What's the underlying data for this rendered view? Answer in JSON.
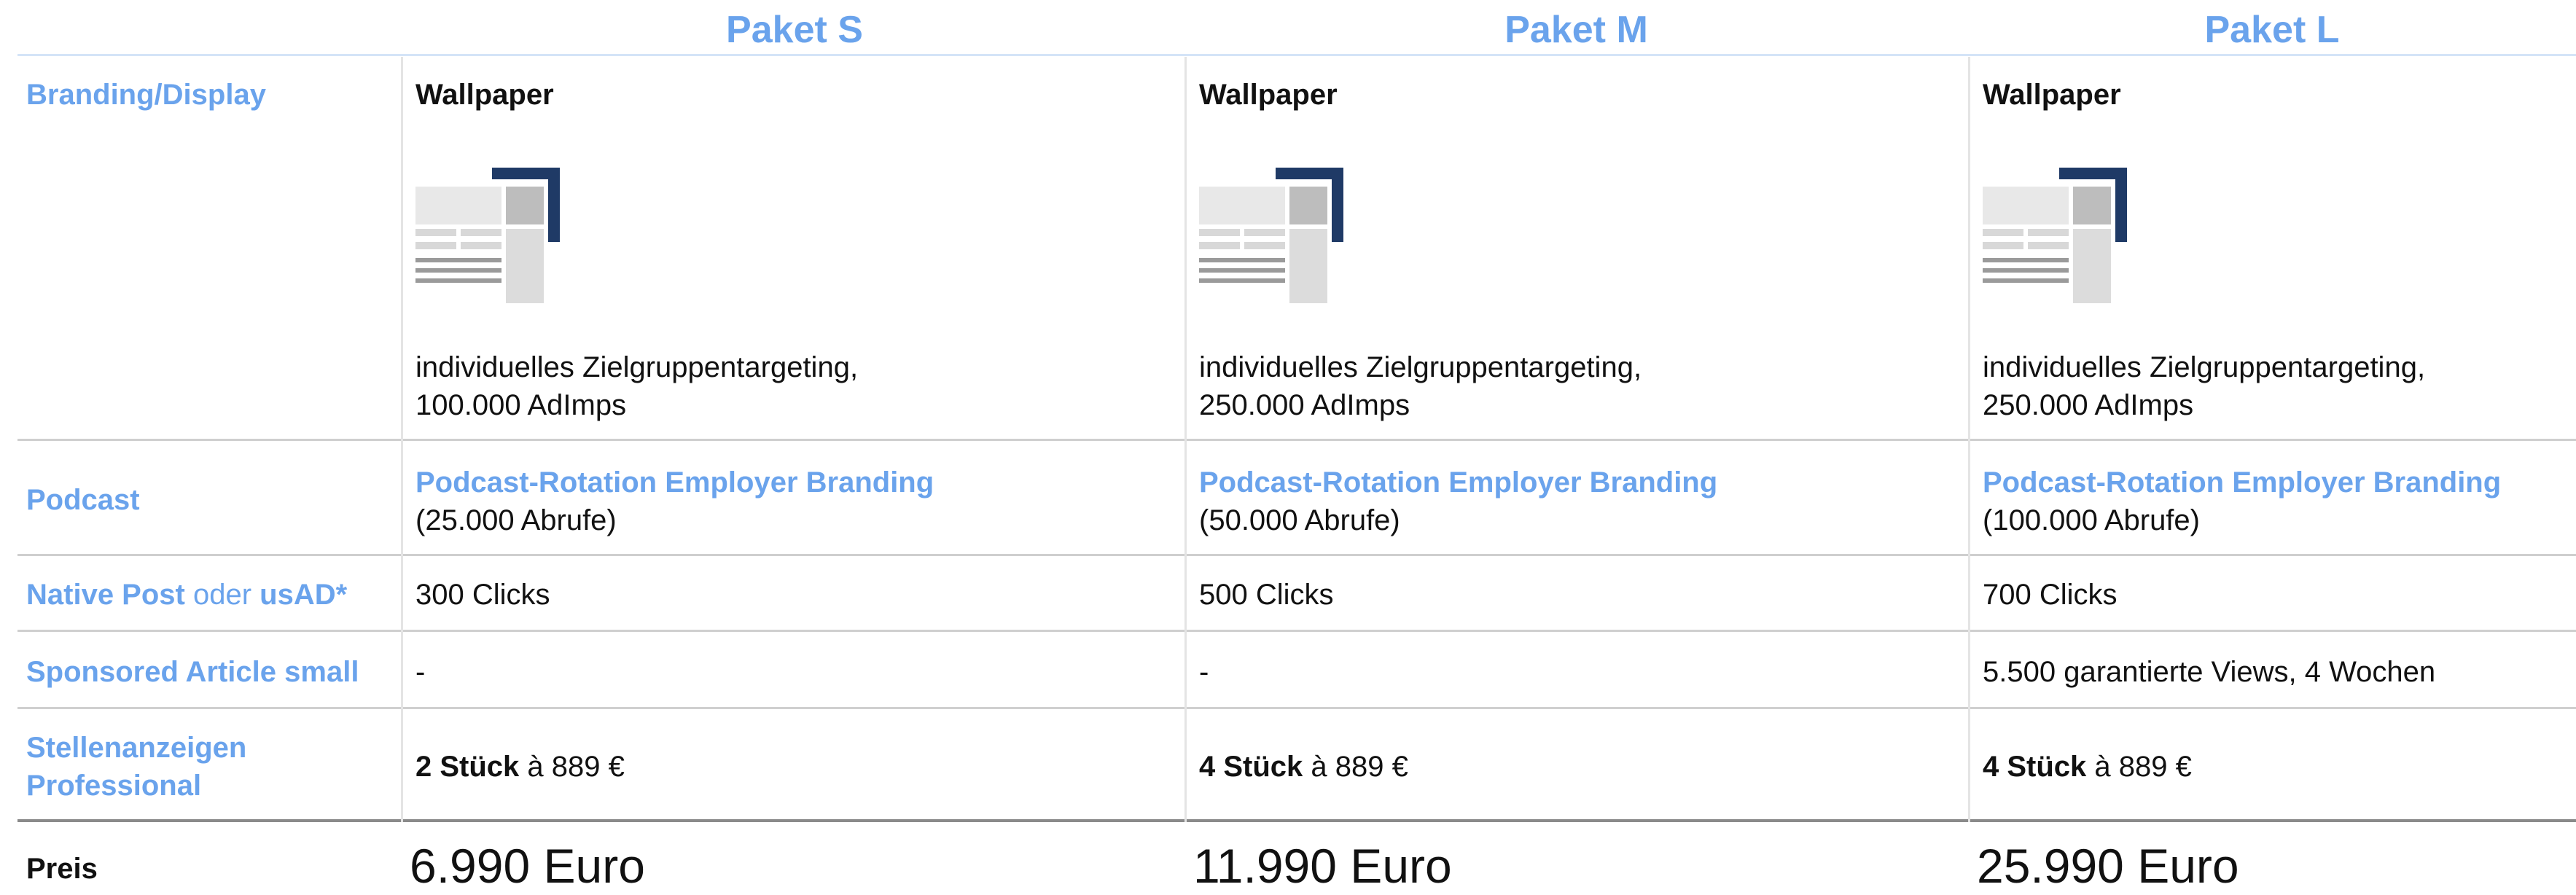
{
  "columns": [
    {
      "title": "Paket S",
      "branding_heading": "Wallpaper",
      "branding_desc": [
        "individuelles Zielgruppentargeting,",
        "100.000 AdImps"
      ],
      "podcast_title": "Podcast-Rotation Employer Branding",
      "podcast_sub": "(25.000 Abrufe)",
      "native": "300 Clicks",
      "sponsored": "-",
      "jobs_bold": "2 Stück",
      "jobs_rest": " à 889 €",
      "price": "6.990 Euro"
    },
    {
      "title": "Paket M",
      "branding_heading": "Wallpaper",
      "branding_desc": [
        "individuelles Zielgruppentargeting,",
        "250.000 AdImps"
      ],
      "podcast_title": "Podcast-Rotation Employer Branding",
      "podcast_sub": "(50.000 Abrufe)",
      "native": "500 Clicks",
      "sponsored": "-",
      "jobs_bold": "4 Stück",
      "jobs_rest": " à 889 €",
      "price": "11.990 Euro"
    },
    {
      "title": "Paket L",
      "branding_heading": "Wallpaper",
      "branding_desc": [
        "individuelles Zielgruppentargeting,",
        "250.000 AdImps"
      ],
      "podcast_title": "Podcast-Rotation Employer Branding",
      "podcast_sub": "(100.000 Abrufe)",
      "native": "700 Clicks",
      "sponsored": "5.500 garantierte Views, 4 Wochen",
      "jobs_bold": "4 Stück",
      "jobs_rest": " à 889 €",
      "price": "25.990 Euro"
    }
  ],
  "rows": {
    "branding": "Branding/Display",
    "podcast": "Podcast",
    "native_a": "Native Post",
    "native_oder": " oder ",
    "native_b": "usAD*",
    "sponsored": "Sponsored Article small",
    "jobs_line1": "Stellenanzeigen",
    "jobs_line2": "Professional",
    "price": "Preis"
  },
  "icons": {
    "wallpaper": "wallpaper-ad-icon"
  },
  "colors": {
    "accent": "#6aa3ec",
    "navy": "#1f3a66",
    "grey": "#c4c4c4"
  }
}
